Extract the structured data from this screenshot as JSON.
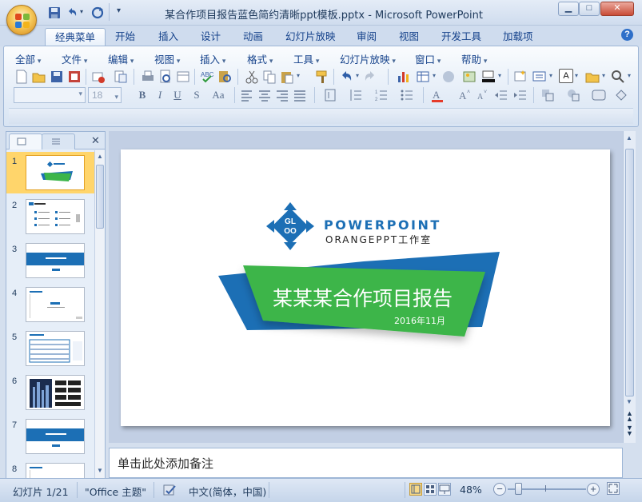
{
  "window": {
    "title": "某合作项目报告蓝色简约清晰ppt模板.pptx - Microsoft PowerPoint",
    "minimize_label": "▁",
    "maximize_label": "□",
    "close_label": "✕"
  },
  "ribbon_tabs": [
    "经典菜单",
    "开始",
    "插入",
    "设计",
    "动画",
    "幻灯片放映",
    "审阅",
    "视图",
    "开发工具",
    "加载项"
  ],
  "active_tab": "经典菜单",
  "menus": [
    "全部",
    "文件",
    "编辑",
    "视图",
    "插入",
    "格式",
    "工具",
    "幻灯片放映",
    "窗口",
    "帮助"
  ],
  "font_name_value": "",
  "font_size_value": "18",
  "format_buttons": [
    "B",
    "I",
    "U",
    "S",
    "Aa"
  ],
  "slides_panel": {
    "close_label": "✕",
    "thumbnails": [
      {
        "num": "1",
        "kind": "title"
      },
      {
        "num": "2",
        "kind": "contents"
      },
      {
        "num": "3",
        "kind": "section"
      },
      {
        "num": "4",
        "kind": "text"
      },
      {
        "num": "5",
        "kind": "table"
      },
      {
        "num": "6",
        "kind": "image"
      },
      {
        "num": "7",
        "kind": "section"
      },
      {
        "num": "8",
        "kind": "text"
      }
    ],
    "selected": "1"
  },
  "slide": {
    "logo_letters": [
      "GL",
      "OO"
    ],
    "brand_title": "POWERPOINT",
    "brand_subtitle": "ORANGEPPT工作室",
    "main_title": "某某某合作项目报告",
    "date": "2016年11月",
    "colors": {
      "blue": "#1c6fb5",
      "green": "#3cb54a",
      "brand_text": "#1c6fb5"
    }
  },
  "notes_placeholder": "单击此处添加备注",
  "status": {
    "slide_info": "幻灯片 1/21",
    "theme": "\"Office 主题\"",
    "language": "中文(简体，中国)",
    "zoom": "48%"
  }
}
